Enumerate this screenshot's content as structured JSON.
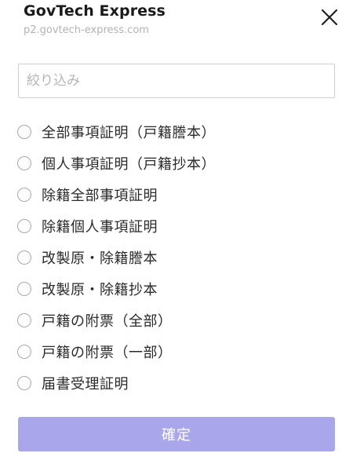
{
  "header": {
    "title": "GovTech Express",
    "url": "p2.govtech-express.com"
  },
  "filter": {
    "placeholder": "絞り込み",
    "value": ""
  },
  "options": [
    {
      "label": "全部事項証明（戸籍謄本）",
      "selected": false
    },
    {
      "label": "個人事項証明（戸籍抄本）",
      "selected": false
    },
    {
      "label": "除籍全部事項証明",
      "selected": false
    },
    {
      "label": "除籍個人事項証明",
      "selected": false
    },
    {
      "label": "改製原・除籍謄本",
      "selected": false
    },
    {
      "label": "改製原・除籍抄本",
      "selected": false
    },
    {
      "label": "戸籍の附票（全部）",
      "selected": false
    },
    {
      "label": "戸籍の附票（一部）",
      "selected": false
    },
    {
      "label": "届書受理証明",
      "selected": false
    }
  ],
  "actions": {
    "confirm_label": "確定"
  },
  "colors": {
    "confirm_button": "#a9a6ec",
    "radio_border": "#a9a9a9",
    "input_border": "#cfcfcf",
    "url_text": "#b3b3b3"
  },
  "icons": {
    "close": "close-icon"
  }
}
